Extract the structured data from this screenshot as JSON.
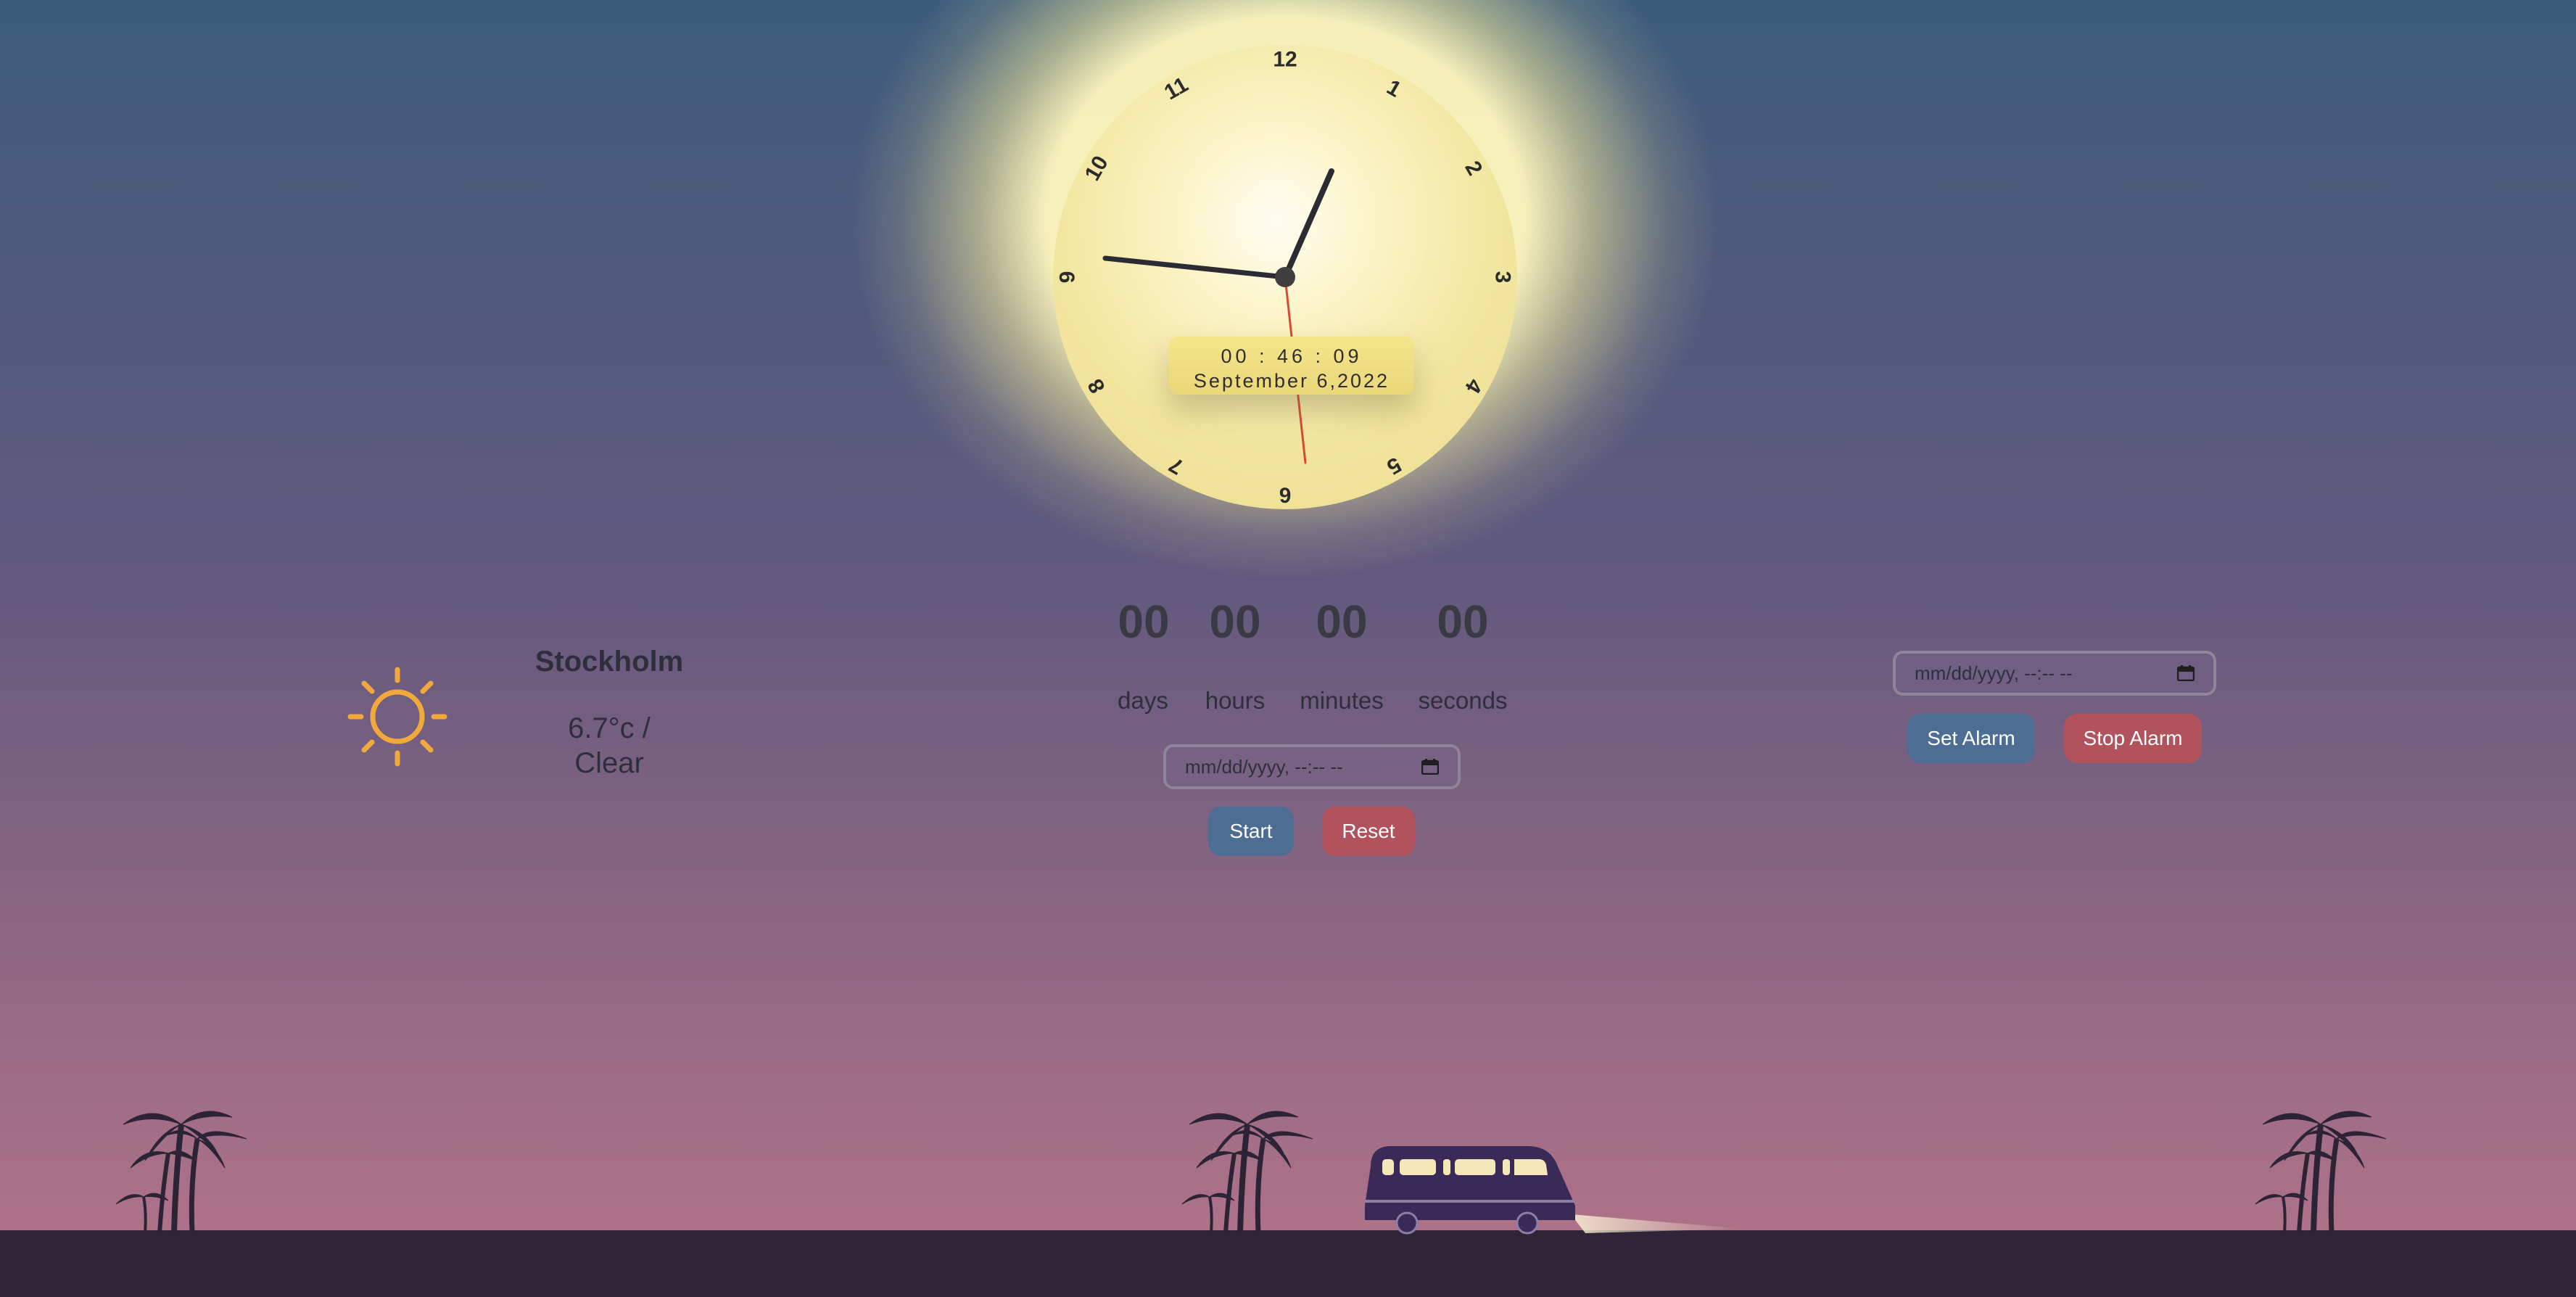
{
  "clock": {
    "numbers": [
      "12",
      "1",
      "2",
      "3",
      "4",
      "5",
      "6",
      "7",
      "8",
      "9",
      "10",
      "11"
    ],
    "digital_time": "00 : 46 : 09",
    "digital_date": "September 6,2022"
  },
  "weather": {
    "icon": "sun-icon",
    "city": "Stockholm",
    "temp_line1": "6.7°c /",
    "temp_line2": "Clear"
  },
  "countdown": {
    "days": "00",
    "hours": "00",
    "minutes": "00",
    "seconds": "00",
    "days_label": "days",
    "hours_label": "hours",
    "minutes_label": "minutes",
    "seconds_label": "seconds",
    "input_placeholder": "mm/dd/yyyy, --:-- --",
    "start_label": "Start",
    "reset_label": "Reset"
  },
  "alarm": {
    "input_placeholder": "mm/dd/yyyy, --:-- --",
    "set_label": "Set Alarm",
    "stop_label": "Stop Alarm"
  },
  "colors": {
    "accent_blue": "#4e6d94",
    "accent_red": "#b1525c",
    "sun_yellow": "#f0a93a",
    "ground": "#2e2538",
    "silhouette": "#2c2436",
    "van": "#3a2a58"
  }
}
